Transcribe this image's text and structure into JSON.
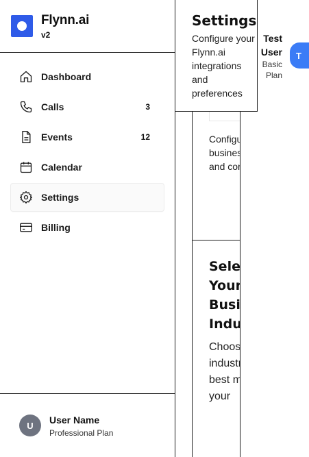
{
  "brand": {
    "name": "Flynn.ai",
    "version": "v2"
  },
  "nav": [
    {
      "label": "Dashboard",
      "icon": "home-icon",
      "count": ""
    },
    {
      "label": "Calls",
      "icon": "phone-icon",
      "count": "3"
    },
    {
      "label": "Events",
      "icon": "document-icon",
      "count": "12"
    },
    {
      "label": "Calendar",
      "icon": "calendar-icon",
      "count": ""
    },
    {
      "label": "Settings",
      "icon": "gear-icon",
      "count": "",
      "active": true
    },
    {
      "label": "Billing",
      "icon": "credit-card-icon",
      "count": ""
    }
  ],
  "footer_user": {
    "initial": "U",
    "name": "User Name",
    "plan": "Professional Plan"
  },
  "settings": {
    "title": "Settings",
    "description": "Configure your Flynn.ai integrations and preferences"
  },
  "top_user": {
    "name": "Test User",
    "plan": "Basic Plan",
    "initial": "T"
  },
  "content": {
    "section_description": "Configure your business industry and core settings",
    "industry_title": "Select Your Business Industry",
    "industry_description": "Choose the industry that best matches your"
  },
  "colors": {
    "accent": "#2f5be8",
    "avatar_blue": "#3b7cf6",
    "avatar_gray": "#6e7380"
  }
}
